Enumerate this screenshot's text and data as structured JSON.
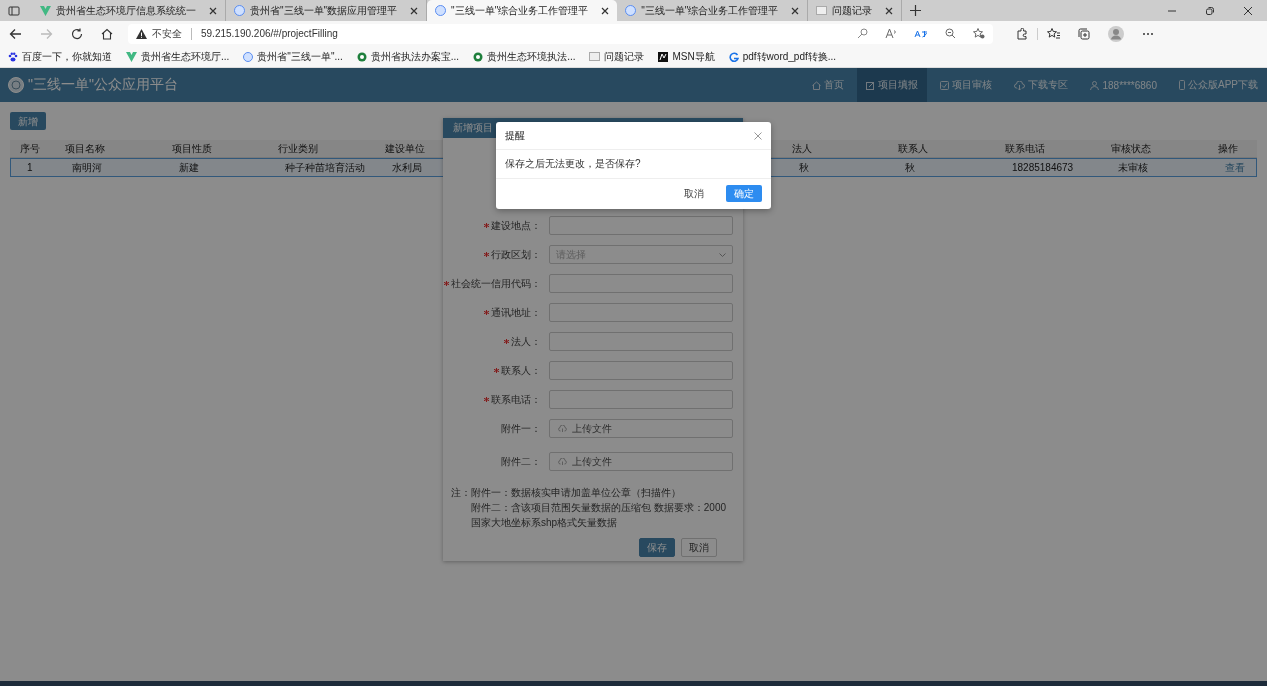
{
  "browser": {
    "tabs": [
      {
        "title": "贵州省生态环境厅信息系统统一",
        "selected": false
      },
      {
        "title": "贵州省\"三线一单\"数据应用管理平",
        "selected": false
      },
      {
        "title": "\"三线一单\"综合业务工作管理平",
        "selected": true
      },
      {
        "title": "\"三线一单\"综合业务工作管理平",
        "selected": false
      },
      {
        "title": "问题记录",
        "selected": false
      }
    ],
    "security": "不安全",
    "url": "59.215.190.206/#/projectFilling",
    "bookmarks": [
      "百度一下，你就知道",
      "贵州省生态环境厅...",
      "贵州省\"三线一单\"...",
      "贵州省执法办案宝...",
      "贵州生态环境执法...",
      "问题记录",
      "MSN导航",
      "pdf转word_pdf转换..."
    ]
  },
  "header": {
    "title": "\"三线一单\"公众应用平台",
    "nav": [
      {
        "label": "首页",
        "selected": false
      },
      {
        "label": "项目填报",
        "selected": true
      },
      {
        "label": "项目审核",
        "selected": false
      },
      {
        "label": "下载专区",
        "selected": false
      }
    ],
    "user": "188****6860",
    "app_download": "公众版APP下载"
  },
  "toolbar": {
    "add_button": "新增"
  },
  "table": {
    "columns": [
      "序号",
      "项目名称",
      "项目性质",
      "行业类别",
      "建设单位",
      "法人",
      "联系人",
      "联系电话",
      "审核状态",
      "操作"
    ],
    "rows": [
      {
        "selected": true,
        "cells": [
          "1",
          "南明河",
          "新建",
          "种子种苗培育活动",
          "水利局",
          "秋",
          "秋",
          "18285184673",
          "未审核"
        ],
        "action": "查看"
      }
    ]
  },
  "form_dialog": {
    "title": "新增项目",
    "fields": [
      {
        "label": "建设地点：",
        "required": true,
        "kind": "input"
      },
      {
        "label": "行政区划：",
        "required": true,
        "kind": "select",
        "placeholder": "请选择"
      },
      {
        "label": "社会统一信用代码：",
        "required": true,
        "kind": "input"
      },
      {
        "label": "通讯地址：",
        "required": true,
        "kind": "input"
      },
      {
        "label": "法人：",
        "required": true,
        "kind": "input"
      },
      {
        "label": "联系人：",
        "required": true,
        "kind": "input"
      },
      {
        "label": "联系电话：",
        "required": true,
        "kind": "input"
      },
      {
        "label": "附件一：",
        "required": false,
        "kind": "upload",
        "placeholder": "上传文件"
      },
      {
        "label": "附件二：",
        "required": false,
        "kind": "upload",
        "placeholder": "上传文件"
      }
    ],
    "note_label": "注：",
    "notes": [
      "附件一：数据核实申请加盖单位公章（扫描件）",
      "附件二：含该项目范围矢量数据的压缩包 数据要求：2000国家大地坐标系shp格式矢量数据"
    ],
    "buttons": [
      {
        "label": "保存",
        "primary": true
      },
      {
        "label": "取消",
        "primary": false
      }
    ]
  },
  "alert": {
    "title": "提醒",
    "message": "保存之后无法更改，是否保存?",
    "buttons": [
      {
        "label": "取消",
        "primary": false
      },
      {
        "label": "确定",
        "primary": true
      }
    ]
  }
}
